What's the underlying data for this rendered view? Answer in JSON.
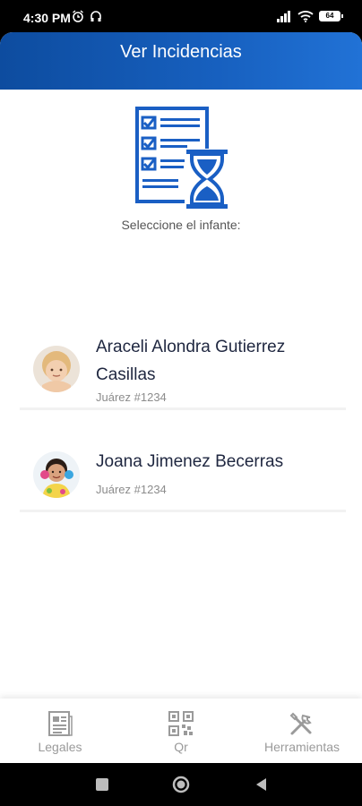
{
  "status_bar": {
    "time": "4:30 PM",
    "battery": "64"
  },
  "app_bar": {
    "title": "Ver Incidencias"
  },
  "hero_icon": "checklist-hourglass-icon",
  "prompt": "Seleccione el infante:",
  "children": [
    {
      "name": "Araceli Alondra Gutierrez Casillas",
      "address": "Juárez #1234"
    },
    {
      "name": "Joana Jimenez Becerras",
      "address": "Juárez #1234"
    }
  ],
  "bottom_nav": [
    {
      "label": "Legales",
      "icon": "document-icon"
    },
    {
      "label": "Qr",
      "icon": "qr-code-icon"
    },
    {
      "label": "Herramientas",
      "icon": "tools-icon"
    }
  ],
  "colors": {
    "brand": "#1760bf",
    "title_text": "#1f2740",
    "muted_text": "#8c8c8c"
  }
}
